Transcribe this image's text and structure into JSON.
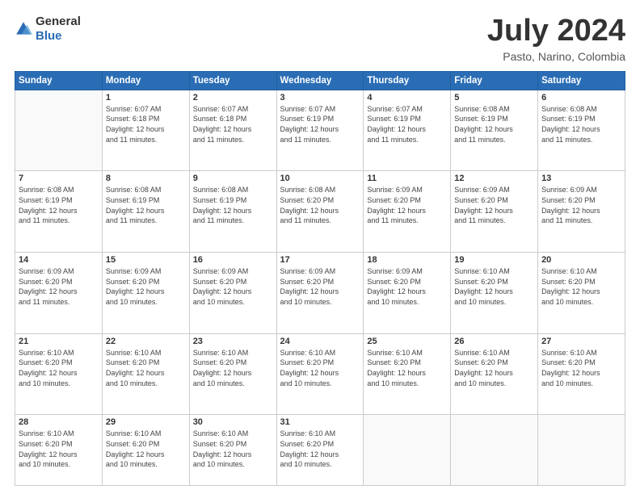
{
  "header": {
    "logo_general": "General",
    "logo_blue": "Blue",
    "month_year": "July 2024",
    "location": "Pasto, Narino, Colombia"
  },
  "weekdays": [
    "Sunday",
    "Monday",
    "Tuesday",
    "Wednesday",
    "Thursday",
    "Friday",
    "Saturday"
  ],
  "weeks": [
    [
      {
        "day": "",
        "info": ""
      },
      {
        "day": "1",
        "info": "Sunrise: 6:07 AM\nSunset: 6:18 PM\nDaylight: 12 hours\nand 11 minutes."
      },
      {
        "day": "2",
        "info": "Sunrise: 6:07 AM\nSunset: 6:18 PM\nDaylight: 12 hours\nand 11 minutes."
      },
      {
        "day": "3",
        "info": "Sunrise: 6:07 AM\nSunset: 6:19 PM\nDaylight: 12 hours\nand 11 minutes."
      },
      {
        "day": "4",
        "info": "Sunrise: 6:07 AM\nSunset: 6:19 PM\nDaylight: 12 hours\nand 11 minutes."
      },
      {
        "day": "5",
        "info": "Sunrise: 6:08 AM\nSunset: 6:19 PM\nDaylight: 12 hours\nand 11 minutes."
      },
      {
        "day": "6",
        "info": "Sunrise: 6:08 AM\nSunset: 6:19 PM\nDaylight: 12 hours\nand 11 minutes."
      }
    ],
    [
      {
        "day": "7",
        "info": "Sunrise: 6:08 AM\nSunset: 6:19 PM\nDaylight: 12 hours\nand 11 minutes."
      },
      {
        "day": "8",
        "info": "Sunrise: 6:08 AM\nSunset: 6:19 PM\nDaylight: 12 hours\nand 11 minutes."
      },
      {
        "day": "9",
        "info": "Sunrise: 6:08 AM\nSunset: 6:19 PM\nDaylight: 12 hours\nand 11 minutes."
      },
      {
        "day": "10",
        "info": "Sunrise: 6:08 AM\nSunset: 6:20 PM\nDaylight: 12 hours\nand 11 minutes."
      },
      {
        "day": "11",
        "info": "Sunrise: 6:09 AM\nSunset: 6:20 PM\nDaylight: 12 hours\nand 11 minutes."
      },
      {
        "day": "12",
        "info": "Sunrise: 6:09 AM\nSunset: 6:20 PM\nDaylight: 12 hours\nand 11 minutes."
      },
      {
        "day": "13",
        "info": "Sunrise: 6:09 AM\nSunset: 6:20 PM\nDaylight: 12 hours\nand 11 minutes."
      }
    ],
    [
      {
        "day": "14",
        "info": "Sunrise: 6:09 AM\nSunset: 6:20 PM\nDaylight: 12 hours\nand 11 minutes."
      },
      {
        "day": "15",
        "info": "Sunrise: 6:09 AM\nSunset: 6:20 PM\nDaylight: 12 hours\nand 10 minutes."
      },
      {
        "day": "16",
        "info": "Sunrise: 6:09 AM\nSunset: 6:20 PM\nDaylight: 12 hours\nand 10 minutes."
      },
      {
        "day": "17",
        "info": "Sunrise: 6:09 AM\nSunset: 6:20 PM\nDaylight: 12 hours\nand 10 minutes."
      },
      {
        "day": "18",
        "info": "Sunrise: 6:09 AM\nSunset: 6:20 PM\nDaylight: 12 hours\nand 10 minutes."
      },
      {
        "day": "19",
        "info": "Sunrise: 6:10 AM\nSunset: 6:20 PM\nDaylight: 12 hours\nand 10 minutes."
      },
      {
        "day": "20",
        "info": "Sunrise: 6:10 AM\nSunset: 6:20 PM\nDaylight: 12 hours\nand 10 minutes."
      }
    ],
    [
      {
        "day": "21",
        "info": "Sunrise: 6:10 AM\nSunset: 6:20 PM\nDaylight: 12 hours\nand 10 minutes."
      },
      {
        "day": "22",
        "info": "Sunrise: 6:10 AM\nSunset: 6:20 PM\nDaylight: 12 hours\nand 10 minutes."
      },
      {
        "day": "23",
        "info": "Sunrise: 6:10 AM\nSunset: 6:20 PM\nDaylight: 12 hours\nand 10 minutes."
      },
      {
        "day": "24",
        "info": "Sunrise: 6:10 AM\nSunset: 6:20 PM\nDaylight: 12 hours\nand 10 minutes."
      },
      {
        "day": "25",
        "info": "Sunrise: 6:10 AM\nSunset: 6:20 PM\nDaylight: 12 hours\nand 10 minutes."
      },
      {
        "day": "26",
        "info": "Sunrise: 6:10 AM\nSunset: 6:20 PM\nDaylight: 12 hours\nand 10 minutes."
      },
      {
        "day": "27",
        "info": "Sunrise: 6:10 AM\nSunset: 6:20 PM\nDaylight: 12 hours\nand 10 minutes."
      }
    ],
    [
      {
        "day": "28",
        "info": "Sunrise: 6:10 AM\nSunset: 6:20 PM\nDaylight: 12 hours\nand 10 minutes."
      },
      {
        "day": "29",
        "info": "Sunrise: 6:10 AM\nSunset: 6:20 PM\nDaylight: 12 hours\nand 10 minutes."
      },
      {
        "day": "30",
        "info": "Sunrise: 6:10 AM\nSunset: 6:20 PM\nDaylight: 12 hours\nand 10 minutes."
      },
      {
        "day": "31",
        "info": "Sunrise: 6:10 AM\nSunset: 6:20 PM\nDaylight: 12 hours\nand 10 minutes."
      },
      {
        "day": "",
        "info": ""
      },
      {
        "day": "",
        "info": ""
      },
      {
        "day": "",
        "info": ""
      }
    ]
  ]
}
